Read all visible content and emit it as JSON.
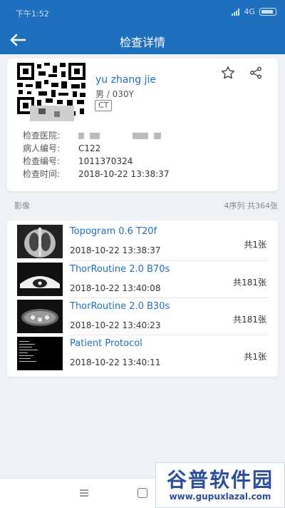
{
  "status_bar": {
    "time": "下午1:52",
    "network": "4G"
  },
  "header": {
    "title": "检查详情"
  },
  "patient": {
    "name": "yu zhang jie",
    "meta": "男 / 030Y",
    "modality": "CT",
    "info": [
      {
        "label": "检查医院:",
        "value": ""
      },
      {
        "label": "病人编号:",
        "value": "C122"
      },
      {
        "label": "检查编号:",
        "value": "1011370324"
      },
      {
        "label": "检查时间:",
        "value": "2018-10-22 13:38:37"
      }
    ]
  },
  "images_section": {
    "title": "影像",
    "summary": "4序列 共364张"
  },
  "series": [
    {
      "name": "Topogram  0.6  T20f",
      "time": "2018-10-22 13:38:37",
      "count": "共1张"
    },
    {
      "name": "ThorRoutine  2.0  B70s",
      "time": "2018-10-22 13:40:08",
      "count": "共181张"
    },
    {
      "name": "ThorRoutine  2.0  B30s",
      "time": "2018-10-22 13:40:23",
      "count": "共181张"
    },
    {
      "name": "Patient Protocol",
      "time": "2018-10-22 13:40:11",
      "count": "共1张"
    }
  ],
  "watermark": {
    "title": "谷普软件园",
    "url": "www.gupuxlazal.com"
  },
  "colors": {
    "primary": "#1f6fbf",
    "background": "#eef1f6",
    "watermark": "#2c4f9c"
  },
  "icons": [
    "back-arrow-icon",
    "star-icon",
    "share-icon",
    "menu-icon",
    "home-icon"
  ]
}
